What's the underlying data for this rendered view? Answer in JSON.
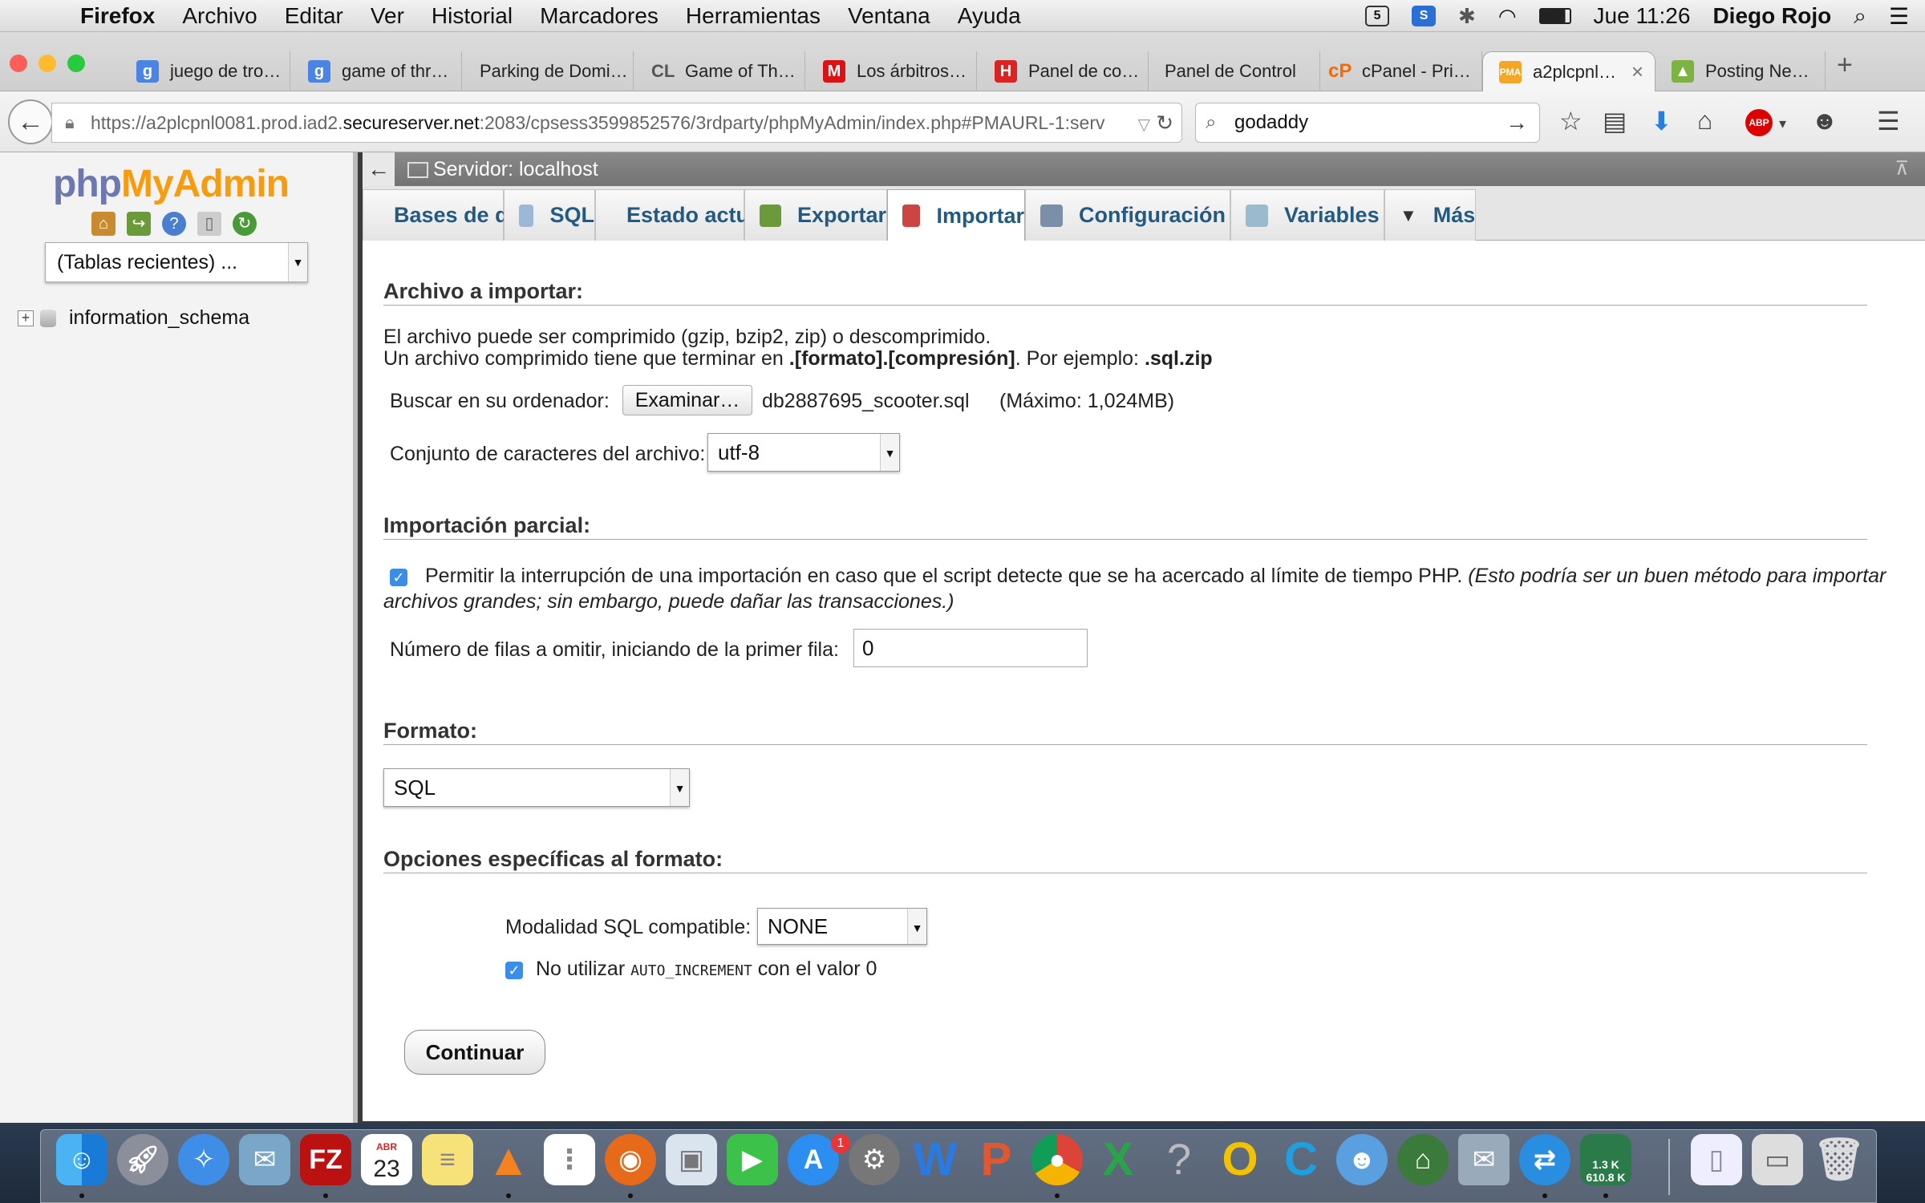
{
  "menubar": {
    "items": [
      "Firefox",
      "Archivo",
      "Editar",
      "Ver",
      "Historial",
      "Marcadores",
      "Herramientas",
      "Ventana",
      "Ayuda"
    ],
    "clock": "Jue 11:26",
    "user": "Diego Rojo"
  },
  "tabs": [
    {
      "label": "juego de tro…",
      "icon": "google-icon"
    },
    {
      "label": "game of thr…",
      "icon": "google-icon"
    },
    {
      "label": "Parking de Domi…",
      "icon": "blank-icon"
    },
    {
      "label": "Game of Th…",
      "icon": "cl-icon"
    },
    {
      "label": "Los árbitros…",
      "icon": "marca-icon"
    },
    {
      "label": "Panel de co…",
      "icon": "hostgator-icon"
    },
    {
      "label": "Panel de Control",
      "icon": "blank-icon"
    },
    {
      "label": "cPanel - Pri…",
      "icon": "cpanel-icon"
    },
    {
      "label": "a2plcpnl…",
      "icon": "phpmyadmin-icon"
    },
    {
      "label": "Posting Ne…",
      "icon": "android-icon"
    }
  ],
  "nav": {
    "url_prefix": "https://a2plcpnl0081.prod.iad2.",
    "url_domain": "secureserver.net",
    "url_suffix": ":2083/cpsess3599852576/3rdparty/phpMyAdmin/index.php#PMAURL-1:serv",
    "search_value": "godaddy"
  },
  "left": {
    "logo_php": "php",
    "logo_myadmin": "MyAdmin",
    "recent_select": "(Tablas recientes) ...",
    "databases": [
      "information_schema"
    ]
  },
  "server": {
    "label": "Servidor: localhost"
  },
  "main_tabs": [
    {
      "label": "Bases de datos",
      "icon": "database-icon"
    },
    {
      "label": "SQL",
      "icon": "sql-icon"
    },
    {
      "label": "Estado actual",
      "icon": "status-icon"
    },
    {
      "label": "Exportar",
      "icon": "export-icon"
    },
    {
      "label": "Importar",
      "icon": "import-icon",
      "active": true
    },
    {
      "label": "Configuración",
      "icon": "wrench-icon"
    },
    {
      "label": "Variables",
      "icon": "variables-icon"
    },
    {
      "label": "Más",
      "icon": "triangle-down-icon"
    }
  ],
  "import": {
    "section1_title": "Archivo a importar:",
    "desc_line1": "El archivo puede ser comprimido (gzip, bzip2, zip) o descomprimido.",
    "desc_line2_a": "Un archivo comprimido tiene que terminar en ",
    "desc_line2_b": ".[formato].[compresión]",
    "desc_line2_c": ". Por ejemplo: ",
    "desc_line2_d": ".sql.zip",
    "browse_label": "Buscar en su ordenador:",
    "browse_button": "Examinar…",
    "file_name": "db2887695_scooter.sql",
    "max_size": "(Máximo: 1,024MB)",
    "charset_label": "Conjunto de caracteres del archivo:",
    "charset_value": "utf-8",
    "section2_title": "Importación parcial:",
    "allow_interrupt": "Permitir la interrupción de una importación en caso que el script detecte que se ha acercado al límite de tiempo PHP.",
    "allow_interrupt_note_1": "(Esto podría ser un buen método para importar",
    "allow_interrupt_note_2": "archivos grandes; sin embargo, puede dañar las transacciones.)",
    "skip_label": "Número de filas a omitir, iniciando de la primer fila:",
    "skip_value": "0",
    "section3_title": "Formato:",
    "format_value": "SQL",
    "section4_title": "Opciones específicas al formato:",
    "compat_label": "Modalidad SQL compatible:",
    "compat_value": "NONE",
    "noauto_a": "No utilizar ",
    "noauto_code": "AUTO_INCREMENT",
    "noauto_b": " con el valor 0",
    "submit": "Continuar"
  },
  "dock": {
    "calendar_month": "ABR",
    "calendar_day": "23",
    "appstore_badge": "1",
    "net_up": "1.3 K",
    "net_down": "610.8 K"
  }
}
